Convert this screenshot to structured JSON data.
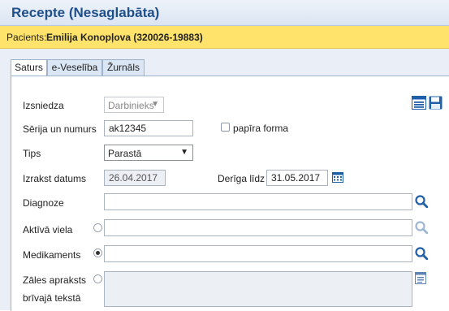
{
  "window": {
    "title": "Recepte (Nesaglabāta)"
  },
  "patient": {
    "label": "Pacients:",
    "value": "Emilija Konopļova (320026-19883)"
  },
  "tabs": [
    {
      "label": "Saturs",
      "active": true
    },
    {
      "label": "e-Veselība",
      "active": false
    },
    {
      "label": "Žurnāls",
      "active": false
    }
  ],
  "form": {
    "issuer": {
      "label": "Izsniedza",
      "value": "Darbinieks"
    },
    "series": {
      "label": "Sērija un numurs",
      "value": "ak12345"
    },
    "paper": {
      "label": "papīra forma",
      "checked": false
    },
    "type": {
      "label": "Tips",
      "value": "Parastā"
    },
    "issue_date": {
      "label": "Izrakst datums",
      "value": "26.04.2017"
    },
    "valid_until": {
      "label": "Derīga līdz",
      "value": "31.05.2017"
    },
    "diagnosis": {
      "label": "Diagnoze",
      "value": ""
    },
    "active_substance": {
      "label": "Aktīvā viela",
      "value": "",
      "selected": false
    },
    "medicament": {
      "label": "Medikaments",
      "value": "",
      "selected": true
    },
    "free_text": {
      "label_line1": "Zāles apraksts",
      "label_line2": "brīvajā tekstā",
      "value": "",
      "selected": false
    }
  },
  "colors": {
    "title": "#1f4f8a",
    "patient_bar": "#ffe36a",
    "icon_blue": "#1f5fa8"
  },
  "icons": [
    "list-icon",
    "save-icon",
    "calendar-icon",
    "search-icon",
    "notes-icon"
  ]
}
